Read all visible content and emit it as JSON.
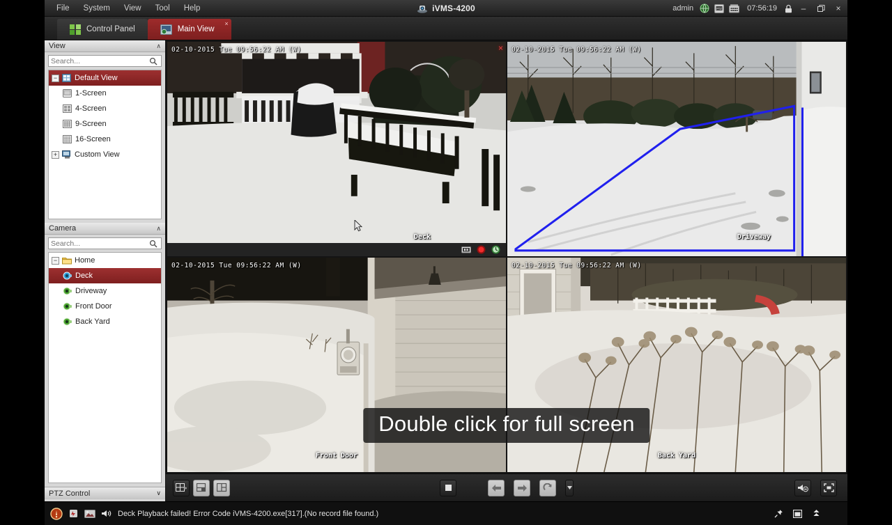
{
  "titlebar": {
    "menus": [
      "File",
      "System",
      "View",
      "Tool",
      "Help"
    ],
    "app_title": "iVMS-4200",
    "app_icon": "camera-logo-icon",
    "user": "admin",
    "icons": [
      "globe-icon",
      "ptz-icon",
      "cam-icon"
    ],
    "clock": "07:56:19",
    "lock_icon": "lock-icon",
    "minimize": "–",
    "restore": "❐",
    "close": "×"
  },
  "tabs": [
    {
      "label": "Control Panel",
      "icon": "control-panel-icon",
      "active": false
    },
    {
      "label": "Main View",
      "icon": "main-view-icon",
      "active": true,
      "close": "×"
    }
  ],
  "sidebar": {
    "view_panel": {
      "title": "View",
      "collapse_chevron": "∧",
      "search_placeholder": "Search...",
      "search_value": "",
      "search_icon": "search-icon",
      "tree": [
        {
          "label": "Default View",
          "icon": "view-grid-icon",
          "toggle": "−",
          "level": 0,
          "selected": true
        },
        {
          "label": "1-Screen",
          "icon": "screen-1-icon",
          "level": 1,
          "selected": false
        },
        {
          "label": "4-Screen",
          "icon": "screen-4-icon",
          "level": 1,
          "selected": false
        },
        {
          "label": "9-Screen",
          "icon": "screen-9-icon",
          "level": 1,
          "selected": false
        },
        {
          "label": "16-Screen",
          "icon": "screen-16-icon",
          "level": 1,
          "selected": false
        },
        {
          "label": "Custom View",
          "icon": "custom-view-icon",
          "toggle": "+",
          "level": 0,
          "selected": false
        }
      ]
    },
    "camera_panel": {
      "title": "Camera",
      "collapse_chevron": "∧",
      "search_placeholder": "Search...",
      "search_value": "",
      "search_icon": "search-icon",
      "tree": [
        {
          "label": "Home",
          "icon": "folder-icon",
          "toggle": "−",
          "level": 0,
          "selected": false
        },
        {
          "label": "Deck",
          "icon": "camera-icon",
          "level": 1,
          "selected": true
        },
        {
          "label": "Driveway",
          "icon": "camera-icon",
          "level": 1,
          "selected": false
        },
        {
          "label": "Front Door",
          "icon": "camera-icon",
          "level": 1,
          "selected": false
        },
        {
          "label": "Back Yard",
          "icon": "camera-icon",
          "level": 1,
          "selected": false
        }
      ]
    },
    "ptz_panel": {
      "title": "PTZ Control",
      "chevron": "∨"
    }
  },
  "video_grid": {
    "layout": "2x2",
    "overlay_message": "Double click for full screen",
    "cells": [
      {
        "camera": "Deck",
        "timestamp": "02-10-2015 Tue 09:56:22 AM (W)",
        "selected": true,
        "close_icon": "×",
        "tools": [
          "capture-icon",
          "record-icon",
          "ptz-icon"
        ],
        "label_position": "lower-right"
      },
      {
        "camera": "Driveway",
        "timestamp": "02-10-2015 Tue 09:56:22 AM (W)",
        "selected": false,
        "label_position": "lower-right",
        "overlay_shape": "blue-detection-polygon",
        "overlay_color": "#2020ee"
      },
      {
        "camera": "Front Door",
        "timestamp": "02-10-2015 Tue 09:56:22 AM (W)",
        "selected": false,
        "label_position": "bottom-center"
      },
      {
        "camera": "Back Yard",
        "timestamp": "02-10-2015 Tue 09:56:22 AM (W)",
        "selected": false,
        "label_position": "bottom-center"
      }
    ]
  },
  "toolbar": {
    "left_buttons": [
      {
        "name": "screen-layout-button",
        "icon": "grid-layout-icon"
      },
      {
        "name": "save-view-button",
        "icon": "save-view-icon"
      },
      {
        "name": "custom-layout-button",
        "icon": "custom-layout-icon"
      }
    ],
    "center_buttons": [
      {
        "name": "stop-all-button",
        "icon": "stop-icon"
      },
      {
        "name": "previous-button",
        "icon": "arrow-left-icon"
      },
      {
        "name": "next-button",
        "icon": "arrow-right-icon"
      },
      {
        "name": "auto-switch-button",
        "icon": "refresh-icon"
      },
      {
        "name": "auto-switch-dropdown",
        "icon": "caret-down-icon"
      }
    ],
    "right_buttons": [
      {
        "name": "audio-mute-button",
        "icon": "speaker-mute-icon"
      },
      {
        "name": "fullscreen-button",
        "icon": "fullscreen-icon"
      }
    ]
  },
  "statusbar": {
    "alarm_icon": "alarm-warning-icon",
    "icons": [
      "event-icon",
      "picture-icon",
      "sound-icon"
    ],
    "message": "Deck Playback failed! Error Code iVMS-4200.exe[317].(No record file found.)",
    "right_icons": [
      "pin-icon",
      "window-icon",
      "expand-icon"
    ]
  },
  "colors": {
    "accent_red": "#8e2525",
    "selection_red": "#7e1f1f",
    "polygon_blue": "#2020ee",
    "record_red": "#d52424",
    "panel_gray": "#d7d7d7"
  }
}
